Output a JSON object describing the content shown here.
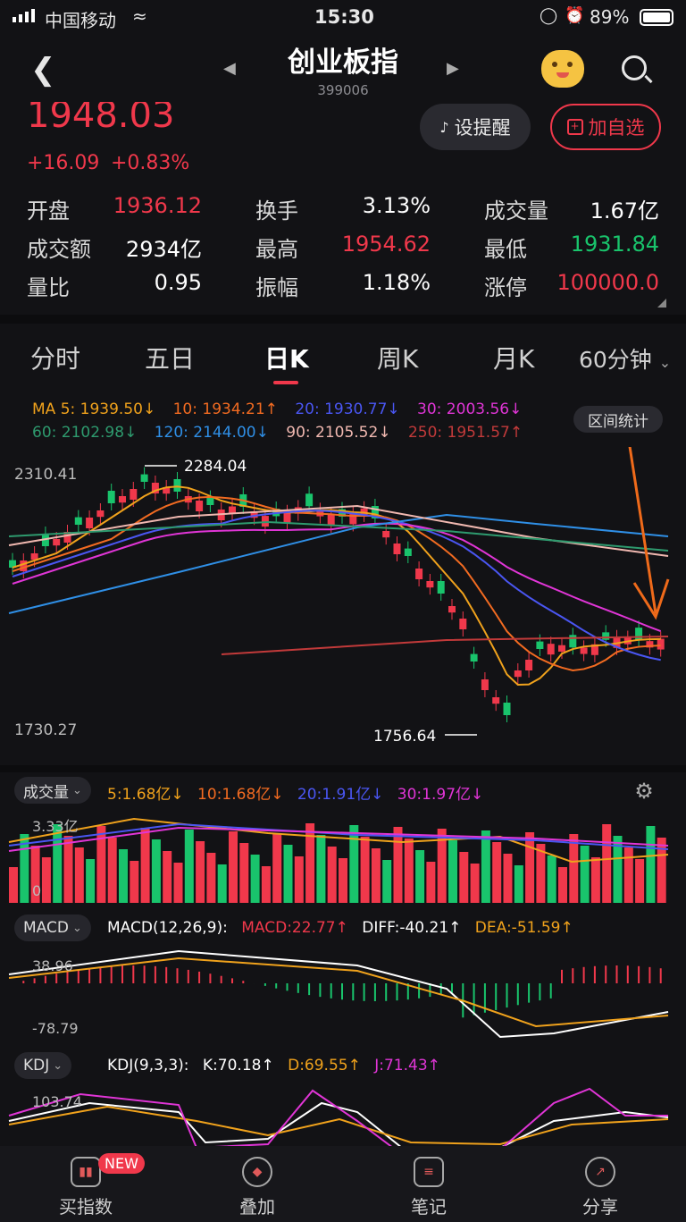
{
  "status_bar": {
    "carrier": "中国移动",
    "time": "15:30",
    "battery": "89%"
  },
  "header": {
    "title": "创业板指",
    "code": "399006"
  },
  "quote": {
    "price": "1948.03",
    "change": "+16.09",
    "change_pct": "+0.83%"
  },
  "buttons": {
    "alert": "设提醒",
    "add_watch": "加自选"
  },
  "stats": [
    {
      "label": "开盘",
      "value": "1936.12",
      "color": "red"
    },
    {
      "label": "换手",
      "value": "3.13%",
      "color": "white"
    },
    {
      "label": "成交量",
      "value": "1.67亿",
      "color": "white"
    },
    {
      "label": "成交额",
      "value": "2934亿",
      "color": "white"
    },
    {
      "label": "最高",
      "value": "1954.62",
      "color": "red"
    },
    {
      "label": "最低",
      "value": "1931.84",
      "color": "green"
    },
    {
      "label": "量比",
      "value": "0.95",
      "color": "white"
    },
    {
      "label": "振幅",
      "value": "1.18%",
      "color": "white"
    },
    {
      "label": "涨停",
      "value": "100000.0",
      "color": "red"
    }
  ],
  "tabs": [
    "分时",
    "五日",
    "日K",
    "周K",
    "月K",
    "60分钟"
  ],
  "active_tab": "日K",
  "ma_line1": [
    {
      "text": "MA 5: 1939.50↓",
      "color": "#f0a21c"
    },
    {
      "text": "10: 1934.21↑",
      "color": "#f26b21"
    },
    {
      "text": "20: 1930.77↓",
      "color": "#4a56f2"
    },
    {
      "text": "30: 2003.56↓",
      "color": "#e035d6"
    }
  ],
  "ma_line2": [
    {
      "text": "60: 2102.98↓",
      "color": "#2e9a6e"
    },
    {
      "text": "120: 2144.00↓",
      "color": "#2f8fe6"
    },
    {
      "text": "90: 2105.52↓",
      "color": "#f0b8b0"
    },
    {
      "text": "250: 1951.57↑",
      "color": "#c23a3a"
    }
  ],
  "range_stat_btn": "区间统计",
  "kline": {
    "y_high": "2310.41",
    "y_low": "1730.27",
    "max_label": "2284.04",
    "min_label": "1756.64"
  },
  "volume": {
    "dropdown": "成交量",
    "items": [
      {
        "text": "5:1.68亿↓",
        "color": "#f0a21c"
      },
      {
        "text": "10:1.68亿↓",
        "color": "#f26b21"
      },
      {
        "text": "20:1.91亿↓",
        "color": "#4a56f2"
      },
      {
        "text": "30:1.97亿↓",
        "color": "#e035d6"
      }
    ],
    "y_top": "3.33亿",
    "y_zero": "0"
  },
  "macd": {
    "dropdown": "MACD",
    "params": "MACD(12,26,9):",
    "items": [
      {
        "text": "MACD:22.77↑",
        "color": "#f0384b"
      },
      {
        "text": "DIFF:-40.21↑",
        "color": "#ffffff"
      },
      {
        "text": "DEA:-51.59↑",
        "color": "#f0a21c"
      }
    ],
    "y_top": "38.96",
    "y_bottom": "-78.79"
  },
  "kdj": {
    "dropdown": "KDJ",
    "params": "KDJ(9,3,3):",
    "items": [
      {
        "text": "K:70.18↑",
        "color": "#ffffff"
      },
      {
        "text": "D:69.55↑",
        "color": "#f0a21c"
      },
      {
        "text": "J:71.43↑",
        "color": "#e035d6"
      }
    ],
    "y_top": "103.74"
  },
  "bottom_nav": [
    {
      "label": "买指数",
      "badge": "NEW"
    },
    {
      "label": "叠加"
    },
    {
      "label": "笔记"
    },
    {
      "label": "分享"
    }
  ]
}
